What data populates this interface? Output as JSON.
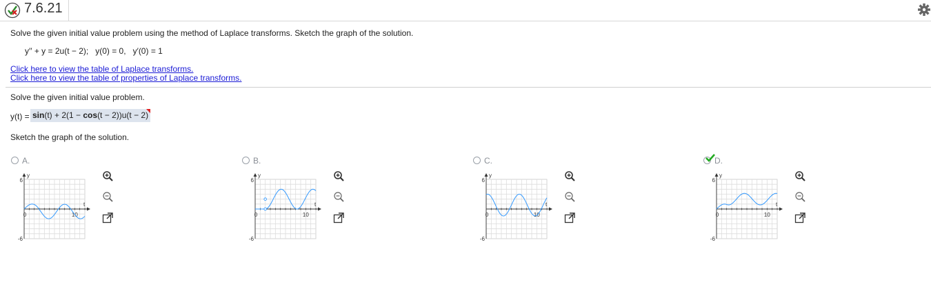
{
  "header": {
    "problem_id": "7.6.21",
    "status_icon": "partially-correct-icon",
    "settings_icon": "gear-icon"
  },
  "question": {
    "instruction": "Solve the given initial value problem using the method of Laplace transforms. Sketch the graph of the solution.",
    "equation": "y′′ + y = 2u(t − 2);   y(0) = 0,   y′(0) = 1",
    "links": [
      "Click here to view the table of Laplace transforms.",
      "Click here to view the table of properties of Laplace transforms."
    ]
  },
  "part1": {
    "prompt": "Solve the given initial value problem.",
    "answer_label": "y(t) =",
    "answer_parts": [
      "sin",
      "(t) + 2(1 − ",
      "cos",
      "(t − 2))u(t − 2)"
    ]
  },
  "part2": {
    "prompt": "Sketch the graph of the solution.",
    "choices": [
      {
        "label": "A.",
        "selected": false
      },
      {
        "label": "B.",
        "selected": false
      },
      {
        "label": "C.",
        "selected": false
      },
      {
        "label": "D.",
        "selected": true
      }
    ],
    "axis_labels": {
      "y": "y",
      "t": "t",
      "y_max": "6",
      "y_min": "-6",
      "x_zero": "0",
      "x_mark": "10"
    }
  },
  "colors": {
    "link": "#1a1ad6",
    "curve": "#3399ff",
    "check": "#22aa22",
    "answer_bg": "#dde4ee"
  }
}
